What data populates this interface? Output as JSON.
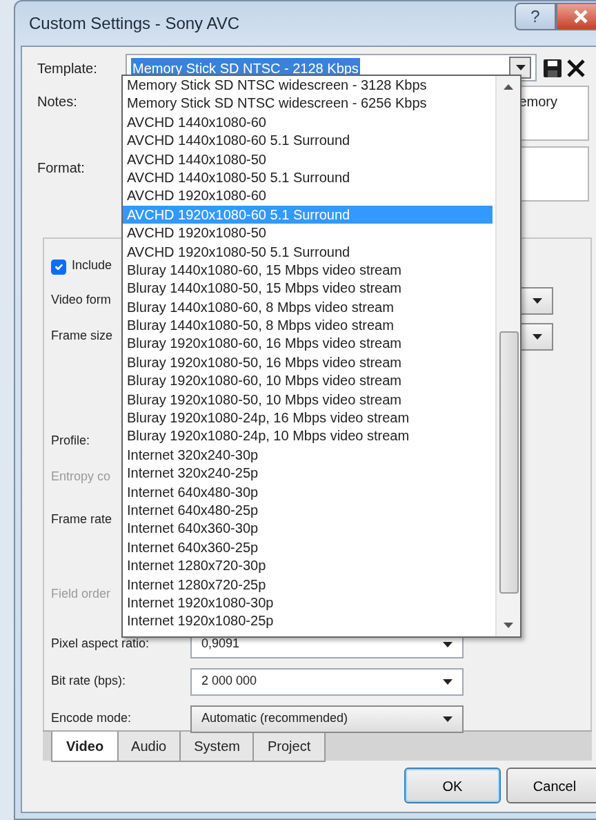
{
  "window": {
    "title": "Custom Settings - Sony AVC",
    "help_button": "?"
  },
  "template": {
    "label": "Template:",
    "value": "Memory Stick SD NTSC - 2128 Kbps",
    "dropdown": {
      "expanded": true,
      "items": [
        {
          "label": "Memory Stick SD NTSC widescreen - 3128 Kbps",
          "selected": false
        },
        {
          "label": "Memory Stick SD NTSC widescreen - 6256 Kbps",
          "selected": false
        },
        {
          "label": "AVCHD 1440x1080-60",
          "selected": false
        },
        {
          "label": "AVCHD 1440x1080-60 5.1 Surround",
          "selected": false
        },
        {
          "label": "AVCHD 1440x1080-50",
          "selected": false
        },
        {
          "label": "AVCHD 1440x1080-50 5.1 Surround",
          "selected": false
        },
        {
          "label": "AVCHD 1920x1080-60",
          "selected": false
        },
        {
          "label": "AVCHD 1920x1080-60 5.1 Surround",
          "selected": true
        },
        {
          "label": "AVCHD 1920x1080-50",
          "selected": false
        },
        {
          "label": "AVCHD 1920x1080-50 5.1 Surround",
          "selected": false
        },
        {
          "label": "Bluray 1440x1080-60, 15 Mbps video stream",
          "selected": false
        },
        {
          "label": "Bluray 1440x1080-50, 15 Mbps video stream",
          "selected": false
        },
        {
          "label": "Bluray 1440x1080-60, 8 Mbps video stream",
          "selected": false
        },
        {
          "label": "Bluray 1440x1080-50, 8 Mbps video stream",
          "selected": false
        },
        {
          "label": "Bluray 1920x1080-60, 16 Mbps video stream",
          "selected": false
        },
        {
          "label": "Bluray 1920x1080-50, 16 Mbps video stream",
          "selected": false
        },
        {
          "label": "Bluray 1920x1080-60, 10 Mbps video stream",
          "selected": false
        },
        {
          "label": "Bluray 1920x1080-50, 10 Mbps video stream",
          "selected": false
        },
        {
          "label": "Bluray 1920x1080-24p, 16 Mbps video stream",
          "selected": false
        },
        {
          "label": "Bluray 1920x1080-24p, 10 Mbps video stream",
          "selected": false
        },
        {
          "label": "Internet 320x240-30p",
          "selected": false
        },
        {
          "label": "Internet 320x240-25p",
          "selected": false
        },
        {
          "label": "Internet 640x480-30p",
          "selected": false
        },
        {
          "label": "Internet 640x480-25p",
          "selected": false
        },
        {
          "label": "Internet 640x360-30p",
          "selected": false
        },
        {
          "label": "Internet 640x360-25p",
          "selected": false
        },
        {
          "label": "Internet 1280x720-30p",
          "selected": false
        },
        {
          "label": "Internet 1280x720-25p",
          "selected": false
        },
        {
          "label": "Internet 1920x1080-30p",
          "selected": false
        },
        {
          "label": "Internet 1920x1080-25p",
          "selected": false
        }
      ]
    }
  },
  "notes": {
    "label": "Notes:",
    "value": "emory"
  },
  "format": {
    "label": "Format:"
  },
  "video_settings": [
    {
      "kind": "checkbox",
      "label": "Include",
      "checked": true,
      "disabled": false
    },
    {
      "kind": "combo",
      "label": "Video form",
      "disabled": false
    },
    {
      "kind": "combo",
      "label": "Frame size",
      "disabled": false
    },
    {
      "kind": "label",
      "label": "Profile:",
      "disabled": false
    },
    {
      "kind": "label",
      "label": "Entropy co",
      "disabled": true
    },
    {
      "kind": "label",
      "label": "Frame rate",
      "disabled": false
    },
    {
      "kind": "label",
      "label": "Field order",
      "disabled": true
    },
    {
      "kind": "value",
      "label": "Pixel aspect ratio:",
      "value": "0,9091",
      "disabled": false
    },
    {
      "kind": "value",
      "label": "Bit rate (bps):",
      "value": "2 000 000",
      "disabled": false
    },
    {
      "kind": "value",
      "label": "Encode mode:",
      "value": "Automatic (recommended)",
      "disabled": false
    }
  ],
  "tabs": [
    {
      "label": "Video",
      "selected": true
    },
    {
      "label": "Audio",
      "selected": false
    },
    {
      "label": "System",
      "selected": false
    },
    {
      "label": "Project",
      "selected": false
    }
  ],
  "buttons": [
    {
      "label": "OK",
      "default": true
    },
    {
      "label": "Cancel",
      "default": false
    }
  ]
}
